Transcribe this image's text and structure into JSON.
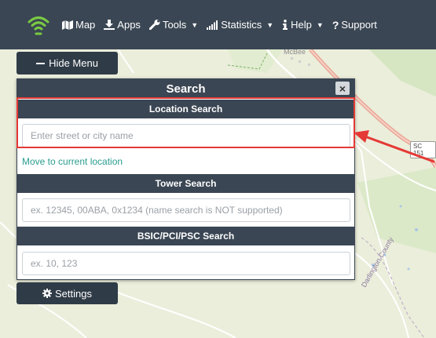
{
  "nav": {
    "items": [
      {
        "label": "Map",
        "icon": "map-icon",
        "dropdown": false
      },
      {
        "label": "Apps",
        "icon": "download-icon",
        "dropdown": false
      },
      {
        "label": "Tools",
        "icon": "wrench-icon",
        "dropdown": true
      },
      {
        "label": "Statistics",
        "icon": "signal-bars-icon",
        "dropdown": true
      },
      {
        "label": "Help",
        "icon": "info-icon",
        "dropdown": true
      },
      {
        "label": "Support",
        "icon": "question-icon",
        "dropdown": false
      }
    ]
  },
  "map": {
    "labels": {
      "town": "McBee",
      "county": "Darlington County",
      "route": "SC 151",
      "road_top": "SC 151"
    }
  },
  "hide_menu": {
    "label": "Hide Menu"
  },
  "settings": {
    "label": "Settings"
  },
  "search_panel": {
    "title": "Search",
    "close_label": "×",
    "location": {
      "header": "Location Search",
      "placeholder": "Enter street or city name",
      "value": ""
    },
    "current_location_link": "Move to current location",
    "tower": {
      "header": "Tower Search",
      "placeholder": "ex. 12345, 00ABA, 0x1234 (name search is NOT supported)",
      "value": ""
    },
    "bsic": {
      "header": "BSIC/PCI/PSC Search",
      "placeholder": "ex. 10, 123",
      "value": ""
    }
  },
  "colors": {
    "navbar": "#3a4653",
    "accent_link": "#2a9d8f",
    "highlight": "#e53935",
    "logo": "#7ac943"
  }
}
